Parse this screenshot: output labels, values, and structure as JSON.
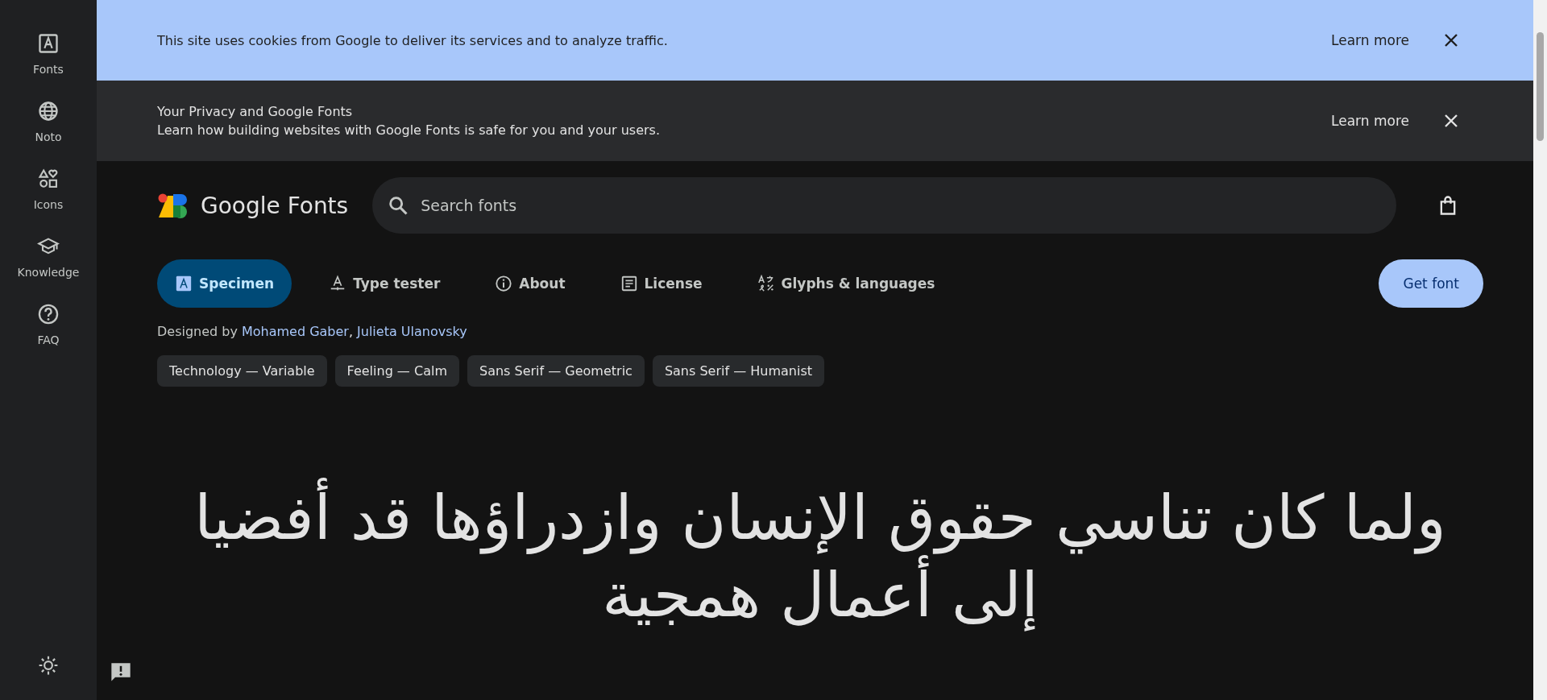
{
  "sidebar": {
    "items": [
      {
        "label": "Fonts"
      },
      {
        "label": "Noto"
      },
      {
        "label": "Icons"
      },
      {
        "label": "Knowledge"
      },
      {
        "label": "FAQ"
      }
    ]
  },
  "banners": [
    {
      "kind": "cookie",
      "text": "This site uses cookies from Google to deliver its services and to analyze traffic.",
      "link": "Learn more"
    },
    {
      "kind": "privacy",
      "title": "Your Privacy and Google Fonts",
      "text": "Learn how building websites with Google Fonts is safe for you and your users.",
      "link": "Learn more"
    }
  ],
  "header": {
    "logo_text": "Google Fonts",
    "search": {
      "placeholder": "Search fonts"
    }
  },
  "tabs": [
    {
      "label": "Specimen",
      "selected": true
    },
    {
      "label": "Type tester",
      "selected": false
    },
    {
      "label": "About",
      "selected": false
    },
    {
      "label": "License",
      "selected": false
    },
    {
      "label": "Glyphs & languages",
      "selected": false
    }
  ],
  "get_font_button": "Get font",
  "designers": {
    "prefix": "Designed by",
    "names": [
      "Mohamed Gaber",
      "Julieta Ulanovsky"
    ],
    "separator": ","
  },
  "tags": [
    "Technology — Variable",
    "Feeling — Calm",
    "Sans Serif — Geometric",
    "Sans Serif — Humanist"
  ],
  "specimen_text": "ولما كان تناسي حقوق الإنسان وازدراؤها قد أفضيا إلى أعمال همجية"
}
